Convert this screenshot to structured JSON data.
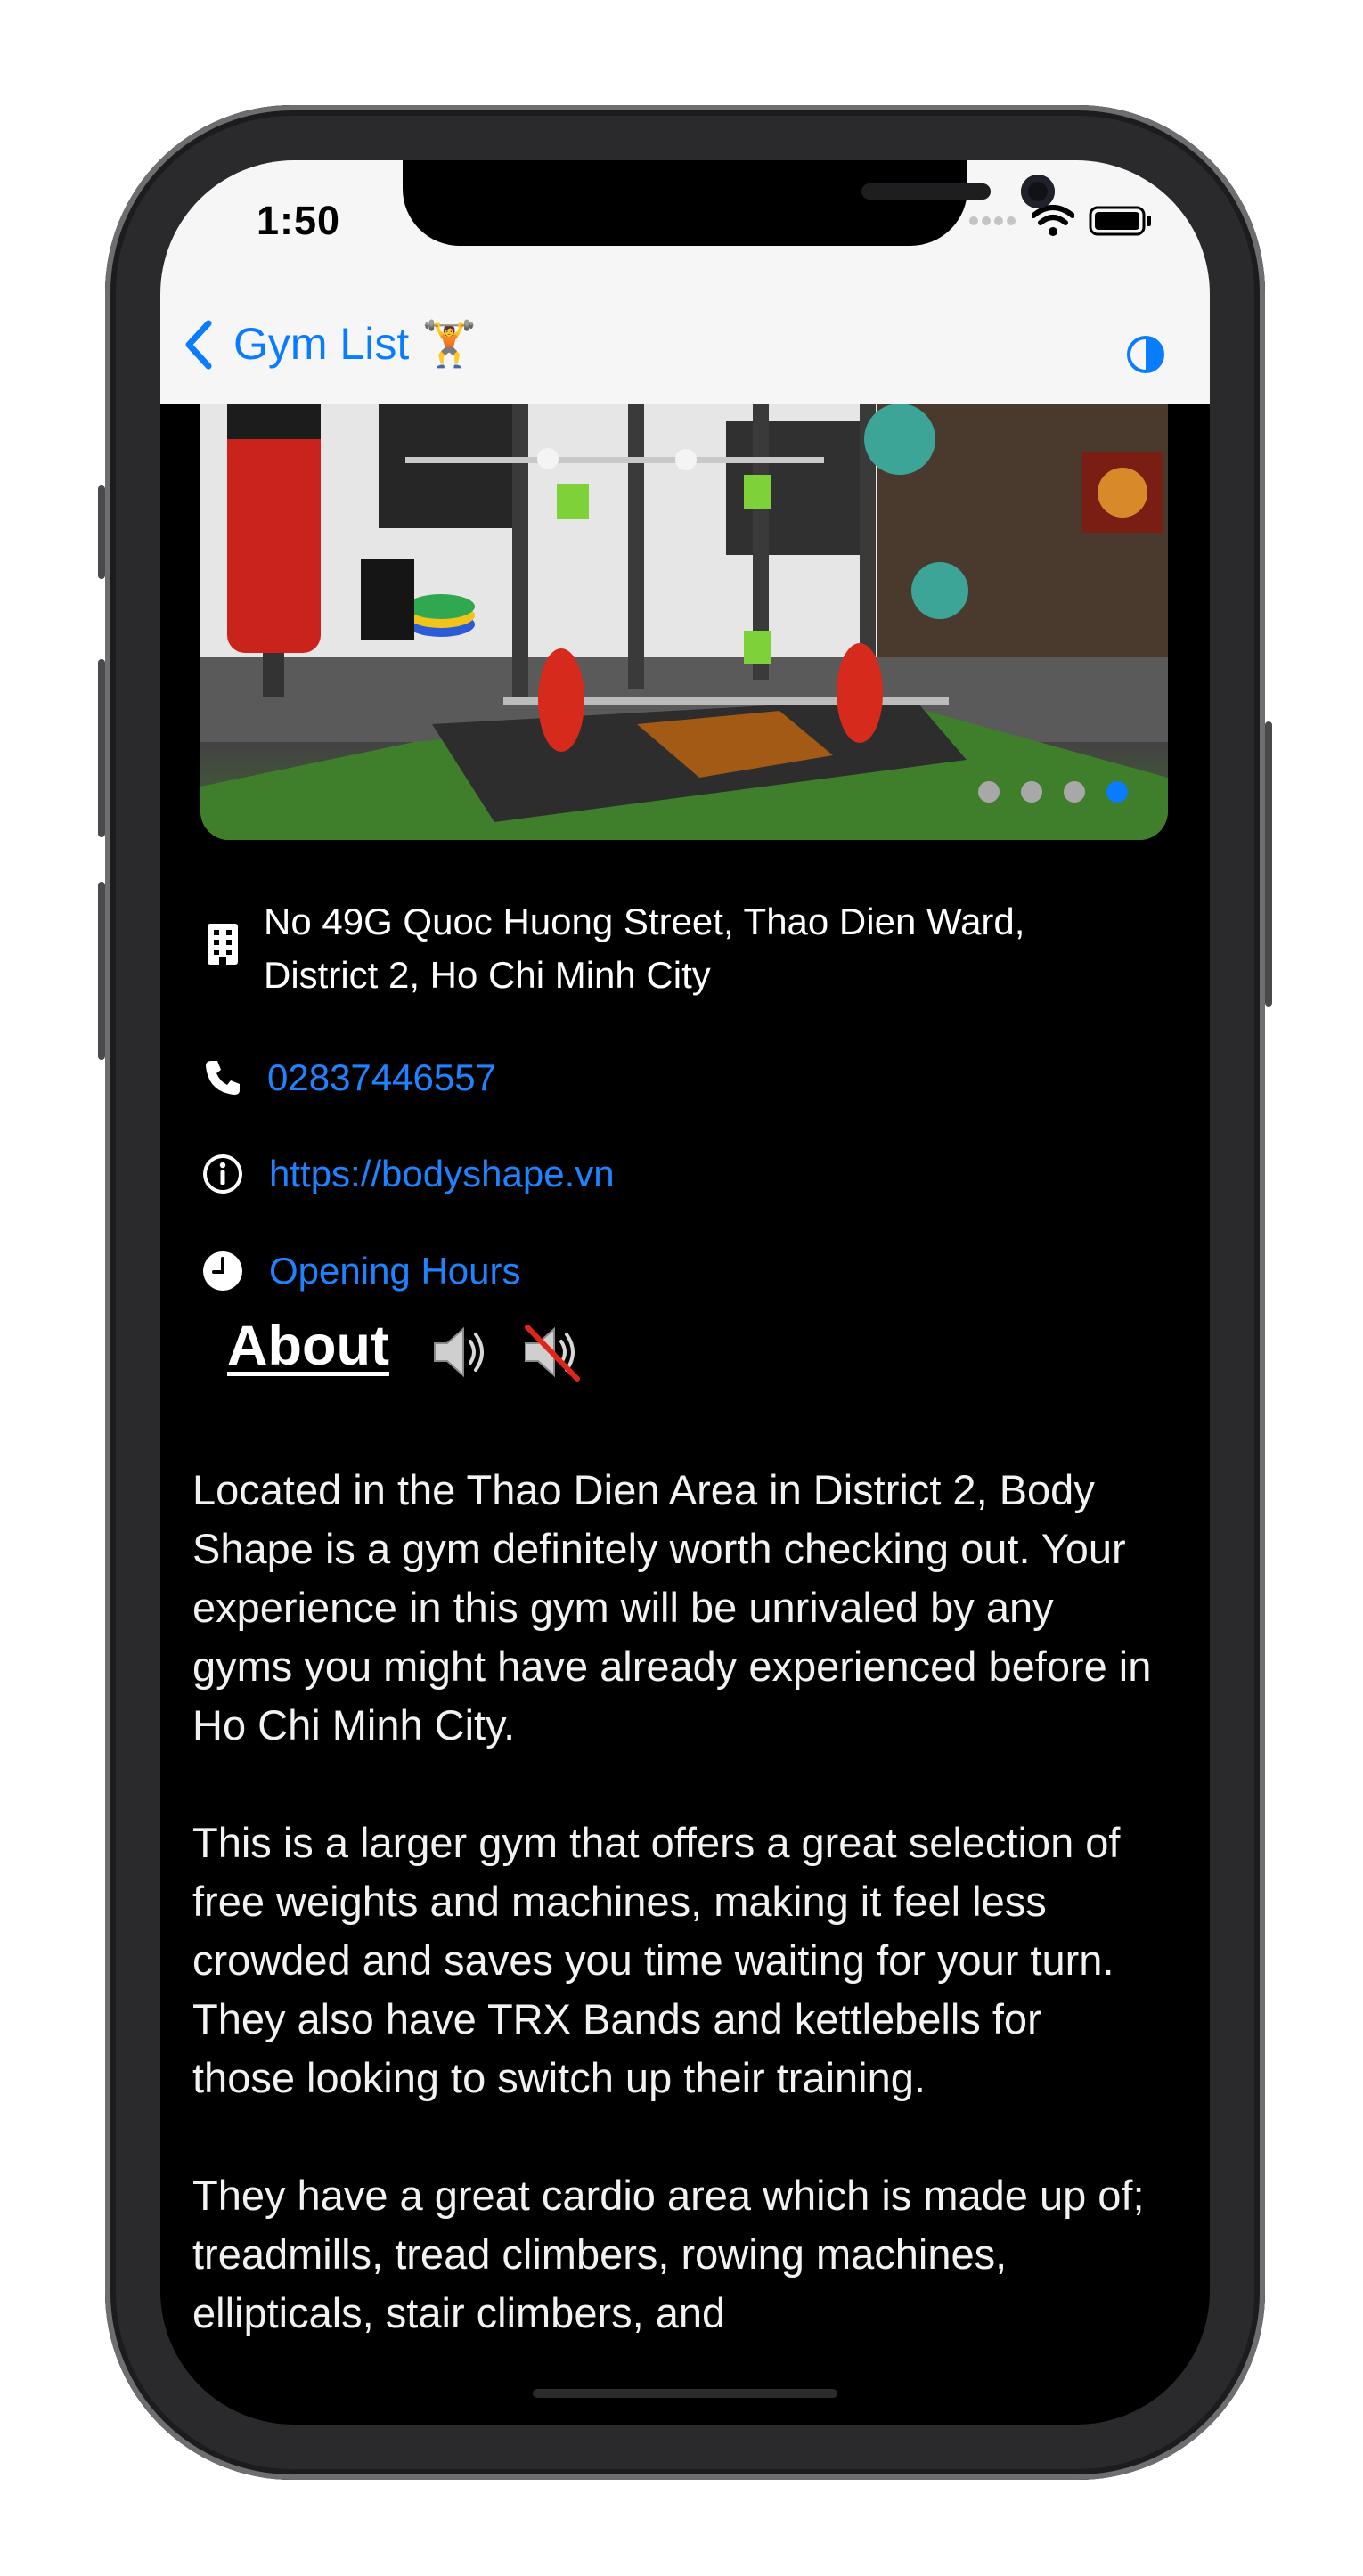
{
  "status_bar": {
    "time": "1:50"
  },
  "nav": {
    "back_label": "Gym List 🏋️"
  },
  "gallery": {
    "page_count": 4,
    "active_index": 3
  },
  "info": {
    "address": "No 49G Quoc Huong Street, Thao Dien Ward, District 2, Ho Chi Minh City",
    "phone": "02837446557",
    "website": "https://bodyshape.vn",
    "hours_label": "Opening Hours"
  },
  "about": {
    "title": "About",
    "paragraphs": [
      "Located in the Thao Dien Area in District 2, Body Shape is a gym definitely worth checking out. Your experience in this gym will be unrivaled by any gyms you might have already experienced before in Ho Chi Minh City.",
      "This is a larger gym that offers a great selection of free weights and machines, making it feel less crowded and saves you time waiting for your turn. They also have TRX Bands and kettlebells for those looking to switch up their training.",
      "They have a great cardio area which is made up of; treadmills, tread climbers, rowing machines, ellipticals, stair climbers, and"
    ]
  },
  "colors": {
    "accent": "#0a7cff",
    "link": "#1f83ff",
    "background": "#000000",
    "navbar": "#f6f6f6"
  },
  "icons": [
    "building-icon",
    "phone-icon",
    "info-icon",
    "clock-icon",
    "speaker-on-icon",
    "speaker-off-icon",
    "contrast-icon",
    "wifi-icon",
    "battery-icon",
    "signal-icon",
    "chevron-left-icon"
  ]
}
